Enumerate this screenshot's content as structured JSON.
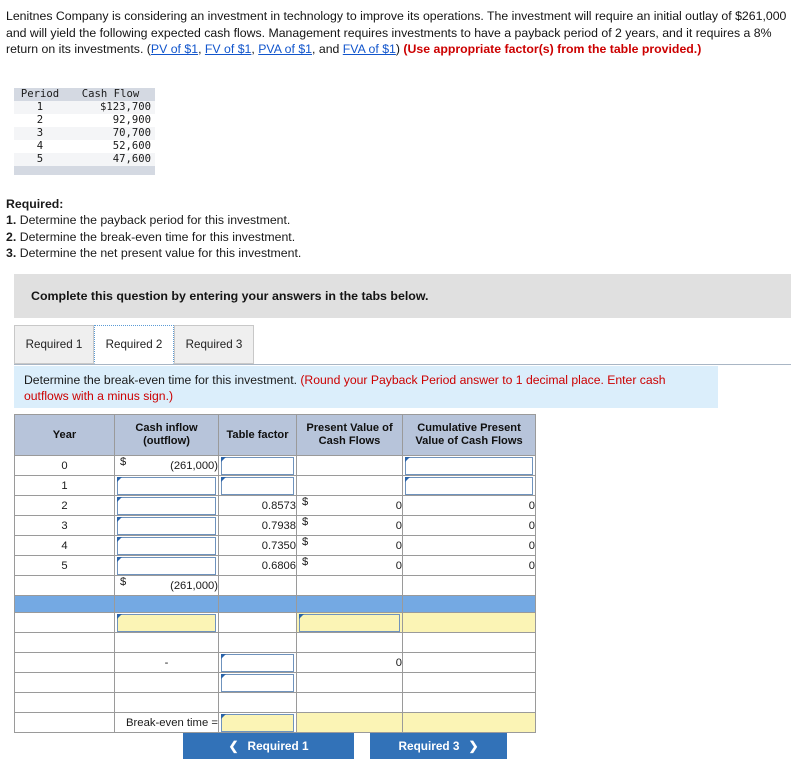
{
  "intro": {
    "part1": "Lenitnes Company is considering an investment in technology to improve its operations. The investment will require an initial outlay of $261,000 and will yield the following expected cash flows. Management requires investments to have a payback period of 2 years, and it requires a 8% return on its investments. (",
    "link1": "PV of $1",
    "sep1": ", ",
    "link2": "FV of $1",
    "sep2": ", ",
    "link3": "PVA of $1",
    "sep3": ", and ",
    "link4": "FVA of $1",
    "part2": ") ",
    "emphasis": "(Use appropriate factor(s) from the table provided.)"
  },
  "cash_flow_table": {
    "headers": [
      "Period",
      "Cash Flow"
    ],
    "rows": [
      {
        "period": "1",
        "cash_flow": "$123,700"
      },
      {
        "period": "2",
        "cash_flow": "92,900"
      },
      {
        "period": "3",
        "cash_flow": "70,700"
      },
      {
        "period": "4",
        "cash_flow": "52,600"
      },
      {
        "period": "5",
        "cash_flow": "47,600"
      }
    ]
  },
  "required": {
    "title": "Required:",
    "items": [
      {
        "num": "1.",
        "text": "Determine the payback period for this investment."
      },
      {
        "num": "2.",
        "text": "Determine the break-even time for this investment."
      },
      {
        "num": "3.",
        "text": "Determine the net present value for this investment."
      }
    ]
  },
  "banner": {
    "text": "Complete this question by entering your answers in the tabs below."
  },
  "tabs": [
    {
      "label": "Required 1",
      "active": false
    },
    {
      "label": "Required 2",
      "active": true
    },
    {
      "label": "Required 3",
      "active": false
    }
  ],
  "instruction": {
    "main": "Determine the break-even time for this investment. ",
    "hint": "(Round your Payback Period answer to 1 decimal place. Enter cash outflows with a minus sign.)"
  },
  "answer_grid": {
    "headers": [
      "Year",
      "Cash inflow (outflow)",
      "Table factor",
      "Present Value of Cash Flows",
      "Cumulative Present Value of Cash Flows"
    ],
    "header_lines": {
      "year": "Year",
      "cash_l1": "Cash inflow",
      "cash_l2": "(outflow)",
      "factor": "Table factor",
      "pv_l1": "Present Value of",
      "pv_l2": "Cash Flows",
      "cum_l1": "Cumulative Present",
      "cum_l2": "Value of Cash Flows"
    },
    "rows": [
      {
        "year": "0",
        "cash_dollar": "$",
        "cash_value": "(261,000)",
        "factor": "",
        "pv_dollar": "",
        "pv_value": "",
        "cum_value": ""
      },
      {
        "year": "1",
        "cash_dollar": "",
        "cash_value": "",
        "factor": "",
        "pv_dollar": "",
        "pv_value": "",
        "cum_value": ""
      },
      {
        "year": "2",
        "cash_dollar": "",
        "cash_value": "",
        "factor": "0.8573",
        "pv_dollar": "$",
        "pv_value": "0",
        "cum_value": "0"
      },
      {
        "year": "3",
        "cash_dollar": "",
        "cash_value": "",
        "factor": "0.7938",
        "pv_dollar": "$",
        "pv_value": "0",
        "cum_value": "0"
      },
      {
        "year": "4",
        "cash_dollar": "",
        "cash_value": "",
        "factor": "0.7350",
        "pv_dollar": "$",
        "pv_value": "0",
        "cum_value": "0"
      },
      {
        "year": "5",
        "cash_dollar": "",
        "cash_value": "",
        "factor": "0.6806",
        "pv_dollar": "$",
        "pv_value": "0",
        "cum_value": "0"
      }
    ],
    "total_row": {
      "dollar": "$",
      "value": "(261,000)"
    },
    "lower_rows": {
      "dash": "-",
      "zero": "0"
    },
    "break_even_label": "Break-even time =",
    "break_even_value": ""
  },
  "nav": {
    "prev_label": "Required 1",
    "prev_icon": "chevron-left-icon",
    "next_label": "Required 3",
    "next_icon": "chevron-right-icon"
  },
  "colors": {
    "header_blue": "#b7c4da",
    "separator_blue": "#74a9e3",
    "input_yellow": "#fbf4b5",
    "button_blue": "#3272b8",
    "link_blue": "#1155cc",
    "red": "#cc0000",
    "banner_grey": "#e0e0e0",
    "instruction_blue": "#dbeefb"
  }
}
